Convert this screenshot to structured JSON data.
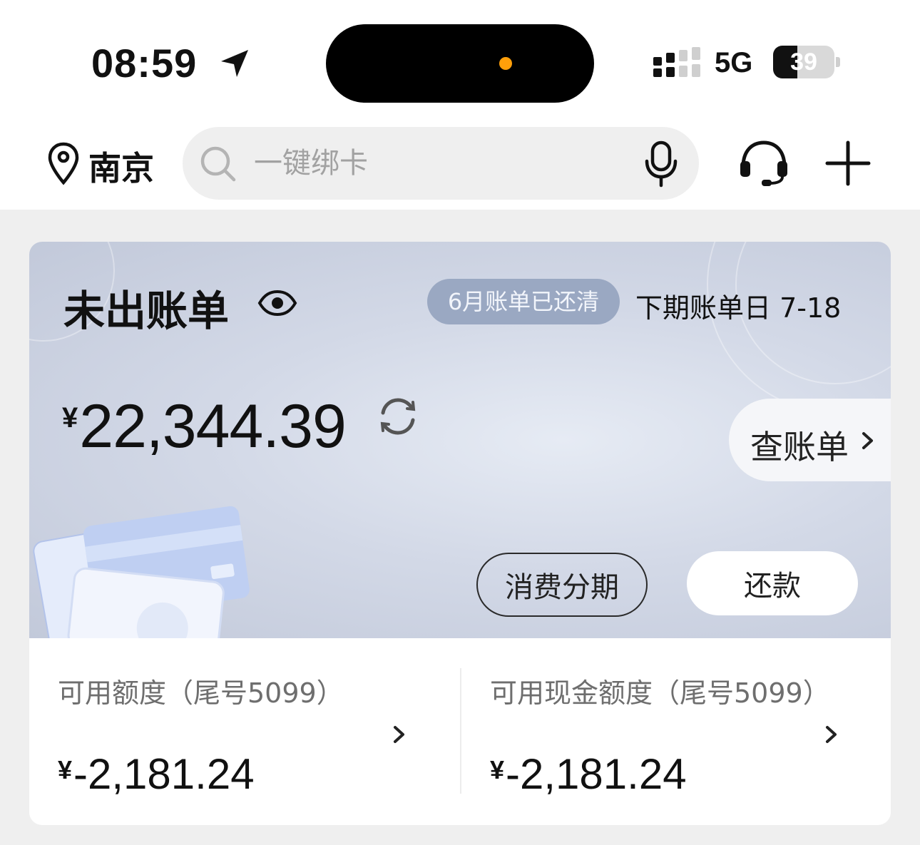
{
  "status_bar": {
    "time": "08:59",
    "network": "5G",
    "battery": "39",
    "battery_level": 0.39,
    "orange_dot_color": "#ff9f0a"
  },
  "top_nav": {
    "city": "南京",
    "location_icon": "location-pin-icon",
    "search_placeholder": "一键绑卡",
    "search_icon": "search-icon",
    "voice_icon": "microphone-icon",
    "service_icon": "headset-icon",
    "add_icon": "plus-icon"
  },
  "bill_card": {
    "title": "未出账单",
    "visibility_icon": "eye-icon",
    "paid_badge": "6月账单已还清",
    "next_bill_date": "下期账单日 7-18",
    "currency": "¥",
    "amount": "22,344.39",
    "refresh_icon": "refresh-icon",
    "view_bill_label": "查账单",
    "installment_label": "消费分期",
    "repay_label": "还款",
    "badge_color": "#9aa8c2"
  },
  "limits": [
    {
      "label": "可用额度（尾号5099）",
      "currency": "¥",
      "value": "-2,181.24"
    },
    {
      "label": "可用现金额度（尾号5099）",
      "currency": "¥",
      "value": "-2,181.24"
    }
  ]
}
